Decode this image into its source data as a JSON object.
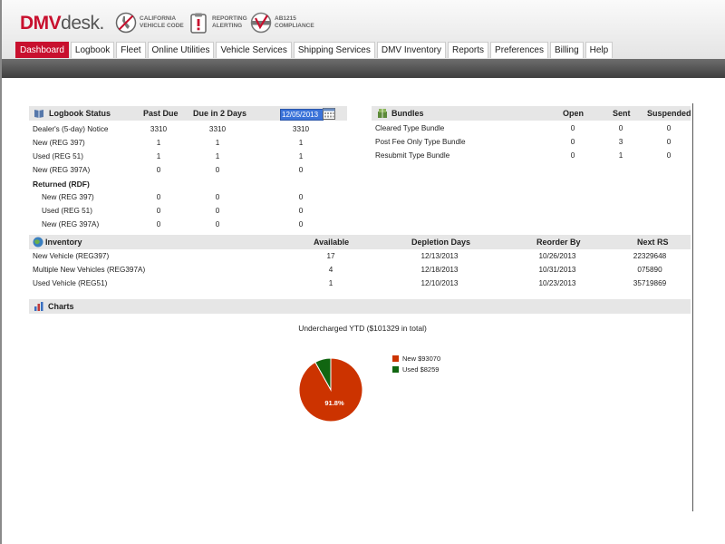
{
  "header": {
    "logo_dmv": "DMV",
    "logo_desk": "desk.",
    "badges": [
      {
        "line1": "CALIFORNIA",
        "line2": "VEHICLE CODE",
        "icon": "california-icon"
      },
      {
        "line1": "REPORTING",
        "line2": "ALERTING",
        "icon": "clipboard-alert-icon"
      },
      {
        "line1": "AB1215",
        "line2": "COMPLIANCE",
        "icon": "compliance-seal-icon"
      }
    ]
  },
  "tabs": [
    "Dashboard",
    "Logbook",
    "Fleet",
    "Online Utilities",
    "Vehicle Services",
    "Shipping Services",
    "DMV Inventory",
    "Reports",
    "Preferences",
    "Billing",
    "Help"
  ],
  "logbook": {
    "title": "Logbook Status",
    "col_past_due": "Past Due",
    "col_due2": "Due in 2 Days",
    "date_value": "12/05/2013",
    "rows": [
      {
        "label": "Dealer's (5-day) Notice",
        "past": "3310",
        "due2": "3310",
        "date": "3310"
      },
      {
        "label": "New (REG 397)",
        "past": "1",
        "due2": "1",
        "date": "1"
      },
      {
        "label": "Used (REG 51)",
        "past": "1",
        "due2": "1",
        "date": "1"
      },
      {
        "label": "New (REG 397A)",
        "past": "0",
        "due2": "0",
        "date": "0"
      },
      {
        "label": "Returned (RDF)",
        "past": "",
        "due2": "",
        "date": ""
      },
      {
        "label": "New (REG 397)",
        "past": "0",
        "due2": "0",
        "date": "0"
      },
      {
        "label": "Used (REG 51)",
        "past": "0",
        "due2": "0",
        "date": "0"
      },
      {
        "label": "New (REG 397A)",
        "past": "0",
        "due2": "0",
        "date": "0"
      }
    ]
  },
  "bundles": {
    "title": "Bundles",
    "col_open": "Open",
    "col_sent": "Sent",
    "col_suspended": "Suspended",
    "rows": [
      {
        "label": "Cleared Type Bundle",
        "open": "0",
        "sent": "0",
        "suspended": "0"
      },
      {
        "label": "Post Fee Only Type Bundle",
        "open": "0",
        "sent": "3",
        "suspended": "0"
      },
      {
        "label": "Resubmit Type Bundle",
        "open": "0",
        "sent": "1",
        "suspended": "0"
      }
    ]
  },
  "inventory": {
    "title": "Inventory",
    "col_available": "Available",
    "col_depletion": "Depletion Days",
    "col_reorder": "Reorder By",
    "col_next": "Next RS",
    "rows": [
      {
        "label": "New Vehicle (REG397)",
        "available": "17",
        "depletion": "12/13/2013",
        "reorder": "10/26/2013",
        "next": "22329648"
      },
      {
        "label": "Multiple New Vehicles (REG397A)",
        "available": "4",
        "depletion": "12/18/2013",
        "reorder": "10/31/2013",
        "next": "075890"
      },
      {
        "label": "Used Vehicle (REG51)",
        "available": "1",
        "depletion": "12/10/2013",
        "reorder": "10/23/2013",
        "next": "35719869"
      }
    ]
  },
  "charts": {
    "title": "Charts"
  },
  "chart_data": {
    "type": "pie",
    "title": "Undercharged YTD ($101329 in total)",
    "categories": [
      "New $93070",
      "Used $8259"
    ],
    "values": [
      93070,
      8259
    ],
    "colors": [
      "#cc3300",
      "#116611"
    ],
    "slice_label": "91.8%",
    "legend": "right"
  }
}
